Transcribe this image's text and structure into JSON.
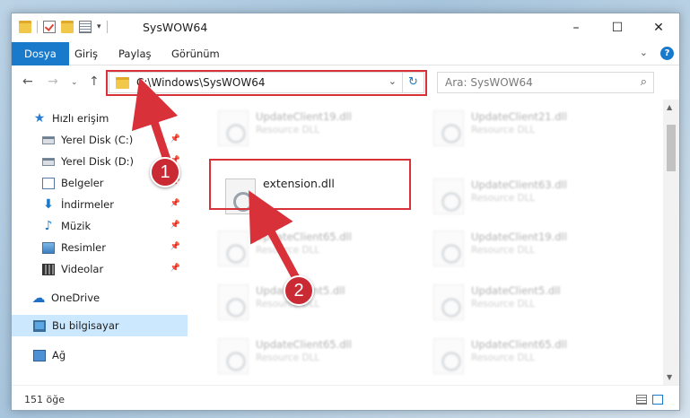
{
  "window": {
    "title": "SysWOW64",
    "controls": {
      "minimize": "–",
      "maximize": "☐",
      "close": "✕"
    }
  },
  "ribbon": {
    "tabs": [
      "Dosya",
      "Giriş",
      "Paylaş",
      "Görünüm"
    ],
    "expand": "⌄",
    "help": "?"
  },
  "address": {
    "path": "C:\\Windows\\SysWOW64",
    "search_placeholder": "Ara: SysWOW64"
  },
  "nav": {
    "items": [
      {
        "label": "Hızlı erişim",
        "icon": "star-icon"
      },
      {
        "label": "Yerel Disk (C:)",
        "icon": "disk-icon",
        "pinned": true
      },
      {
        "label": "Yerel Disk (D:)",
        "icon": "disk-icon",
        "pinned": true
      },
      {
        "label": "Belgeler",
        "icon": "documents-icon",
        "pinned": true
      },
      {
        "label": "İndirmeler",
        "icon": "download-icon",
        "pinned": true
      },
      {
        "label": "Müzik",
        "icon": "music-icon",
        "pinned": true
      },
      {
        "label": "Resimler",
        "icon": "pictures-icon",
        "pinned": true
      },
      {
        "label": "Videolar",
        "icon": "video-icon",
        "pinned": true
      },
      {
        "label": "OneDrive",
        "icon": "cloud-icon"
      },
      {
        "label": "Bu bilgisayar",
        "icon": "computer-icon",
        "selected": true
      },
      {
        "label": "Ağ",
        "icon": "network-icon"
      }
    ]
  },
  "files": [
    {
      "name": "UpdateClient19.dll",
      "desc": "Resource DLL"
    },
    {
      "name": "UpdateClient21.dll",
      "desc": "Resource DLL"
    },
    {
      "name": "extension.dll",
      "desc": ""
    },
    {
      "name": "UpdateClient63.dll",
      "desc": "Resource DLL"
    },
    {
      "name": "UpdateClient65.dll",
      "desc": "Resource DLL"
    },
    {
      "name": "UpdateClient19.dll",
      "desc": "Resource DLL"
    },
    {
      "name": "UpdateClient5.dll",
      "desc": "Resource DLL"
    },
    {
      "name": "UpdateClient5.dll",
      "desc": "Resource DLL"
    },
    {
      "name": "UpdateClient65.dll",
      "desc": "Resource DLL"
    },
    {
      "name": "UpdateClient65.dll",
      "desc": "Resource DLL"
    }
  ],
  "status": {
    "count": "151 öğe"
  },
  "callouts": [
    "1",
    "2"
  ],
  "colors": {
    "accent": "#1979ca",
    "highlight": "#d9313a",
    "selection": "#cce8ff"
  }
}
